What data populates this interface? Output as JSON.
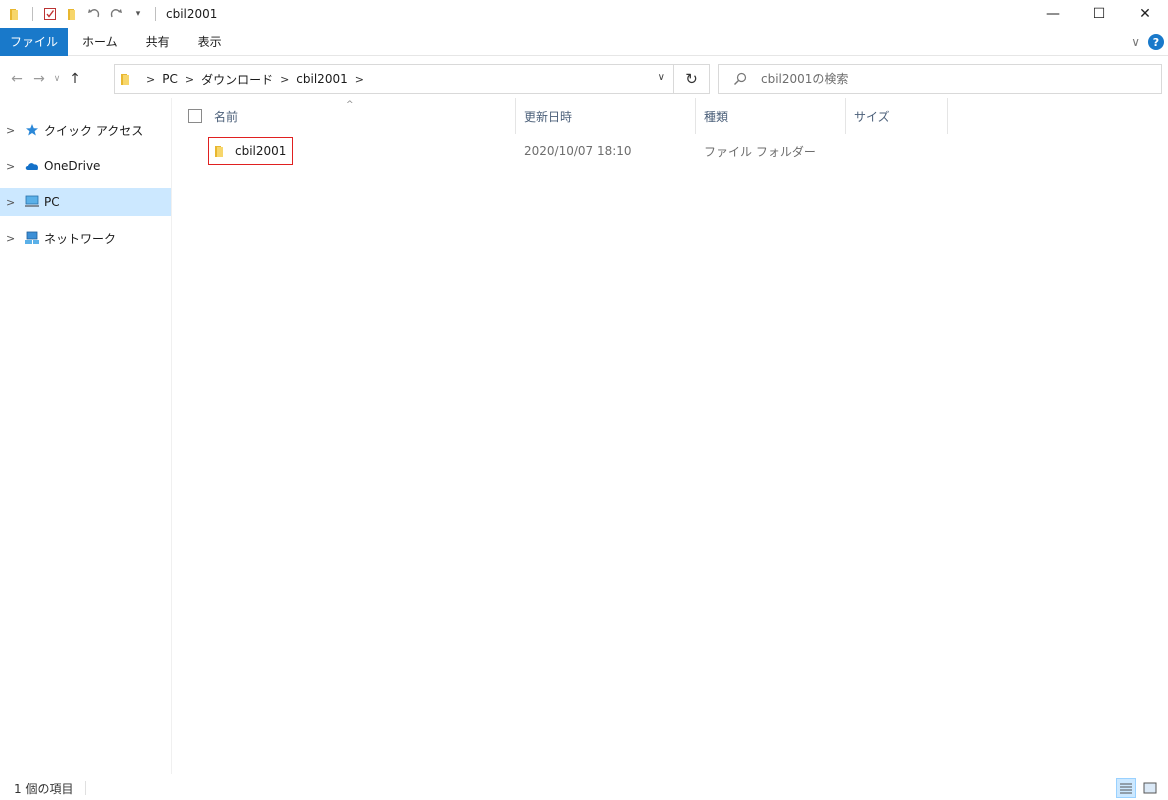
{
  "window": {
    "title": "cbil2001",
    "controls": {
      "minimize": "—",
      "maximize": "☐",
      "close": "✕"
    }
  },
  "ribbon": {
    "tabs": [
      {
        "label": "ファイル",
        "active": true
      },
      {
        "label": "ホーム"
      },
      {
        "label": "共有"
      },
      {
        "label": "表示"
      }
    ]
  },
  "navigation": {
    "breadcrumbs": [
      "PC",
      "ダウンロード",
      "cbil2001"
    ],
    "search_placeholder": "cbil2001の検索"
  },
  "sidebar": {
    "items": [
      {
        "label": "クイック アクセス",
        "icon": "star-icon"
      },
      {
        "label": "OneDrive",
        "icon": "cloud-icon"
      },
      {
        "label": "PC",
        "icon": "pc-icon",
        "selected": true
      },
      {
        "label": "ネットワーク",
        "icon": "network-icon"
      }
    ]
  },
  "file_list": {
    "columns": {
      "name": "名前",
      "modified": "更新日時",
      "type": "種類",
      "size": "サイズ"
    },
    "rows": [
      {
        "name": "cbil2001",
        "modified": "2020/10/07 18:10",
        "type": "ファイル フォルダー",
        "size": ""
      }
    ]
  },
  "status": {
    "item_count": "1 個の項目"
  },
  "colors": {
    "accent": "#1979ca",
    "selection": "#cce8ff",
    "highlight_box": "#e02020",
    "folder": "#f0c24b"
  }
}
